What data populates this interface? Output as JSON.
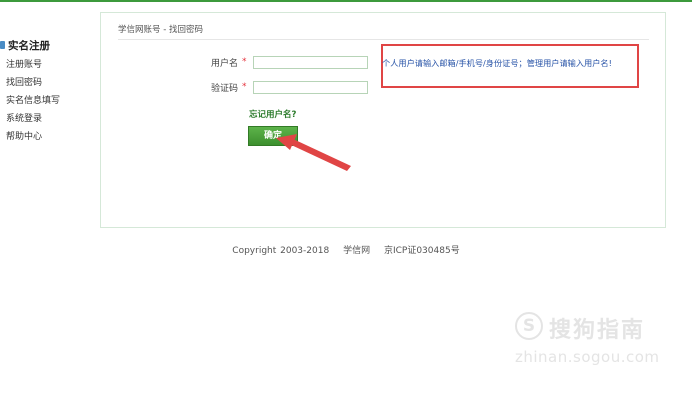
{
  "sidebar": {
    "heading": "实名注册",
    "items": [
      {
        "label": "注册账号"
      },
      {
        "label": "找回密码"
      },
      {
        "label": "实名信息填写"
      },
      {
        "label": "系统登录"
      },
      {
        "label": "帮助中心"
      }
    ]
  },
  "breadcrumb": "学信网账号 - 找回密码",
  "form": {
    "username_label": "用户名",
    "captcha_label": "验证码",
    "required_mark": "*",
    "username_value": "",
    "captcha_value": "",
    "forgot_link": "忘记用户名?",
    "confirm_button": "确定"
  },
  "hint": "个人用户请输入邮箱/手机号/身份证号；管理用户请输入用户名!",
  "footer": {
    "copyright": "Copyright 2003-2018",
    "site": "学信网",
    "icp": "京ICP证030485号"
  },
  "watermark": {
    "name": "搜狗指南",
    "domain": "zhinan.sogou.com"
  },
  "colors": {
    "accent_green": "#3c9a3c",
    "annotation_red": "#e04545",
    "hint_blue": "#2a55a8"
  }
}
